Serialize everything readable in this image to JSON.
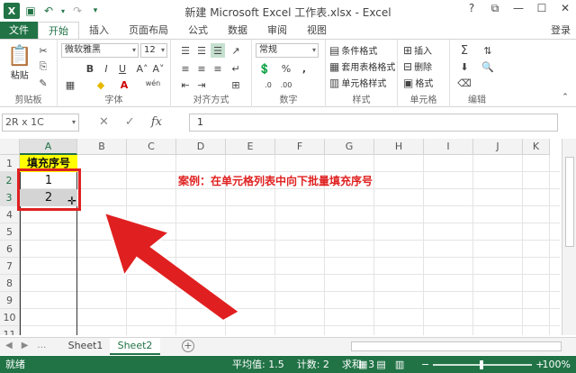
{
  "window": {
    "title": "新建 Microsoft Excel 工作表.xlsx - Excel",
    "controls": [
      "?",
      "⧉",
      "—",
      "☐",
      "✕"
    ],
    "login": "登录"
  },
  "tabs": [
    "文件",
    "开始",
    "插入",
    "页面布局",
    "公式",
    "数据",
    "审阅",
    "视图"
  ],
  "ribbon": {
    "clipboard": {
      "label": "剪贴板",
      "paste": "粘贴"
    },
    "font": {
      "label": "字体",
      "name": "微软雅黑",
      "size": "12",
      "bold": "B",
      "italic": "I",
      "underline": "U",
      "grow": "A˄",
      "shrink": "A˅",
      "wen": "wén"
    },
    "align": {
      "label": "对齐方式"
    },
    "number": {
      "label": "数字",
      "format": "常规",
      "percent": "%",
      "comma": ","
    },
    "styles": {
      "label": "样式",
      "cond": "条件格式",
      "table": "套用表格格式",
      "cell": "单元格样式"
    },
    "cells": {
      "label": "单元格",
      "insert": "插入",
      "delete": "删除",
      "format": "格式"
    },
    "editing": {
      "label": "编辑"
    }
  },
  "formula_bar": {
    "name_box": "2R x 1C",
    "cancel": "✕",
    "enter": "✓",
    "fx": "fx",
    "value": "1"
  },
  "grid": {
    "columns": [
      "A",
      "B",
      "C",
      "D",
      "E",
      "F",
      "G",
      "H",
      "I",
      "J",
      "K"
    ],
    "rows": [
      "1",
      "2",
      "3",
      "4",
      "5",
      "6",
      "7",
      "8",
      "9",
      "10",
      "11"
    ],
    "a1": "填充序号",
    "a2": "1",
    "a3": "2",
    "note": "案例：在单元格列表中向下批量填充序号"
  },
  "sheets": {
    "tabs": [
      "Sheet1",
      "Sheet2"
    ],
    "active": "Sheet2",
    "add": "+"
  },
  "status": {
    "ready": "就绪",
    "average": "平均值: 1.5",
    "count": "计数: 2",
    "sum": "求和: 3",
    "zoom": "100%",
    "zoom_minus": "−",
    "zoom_plus": "+"
  },
  "colors": {
    "accent": "#217346",
    "highlight": "#ffff00",
    "annotation": "#e02020"
  }
}
